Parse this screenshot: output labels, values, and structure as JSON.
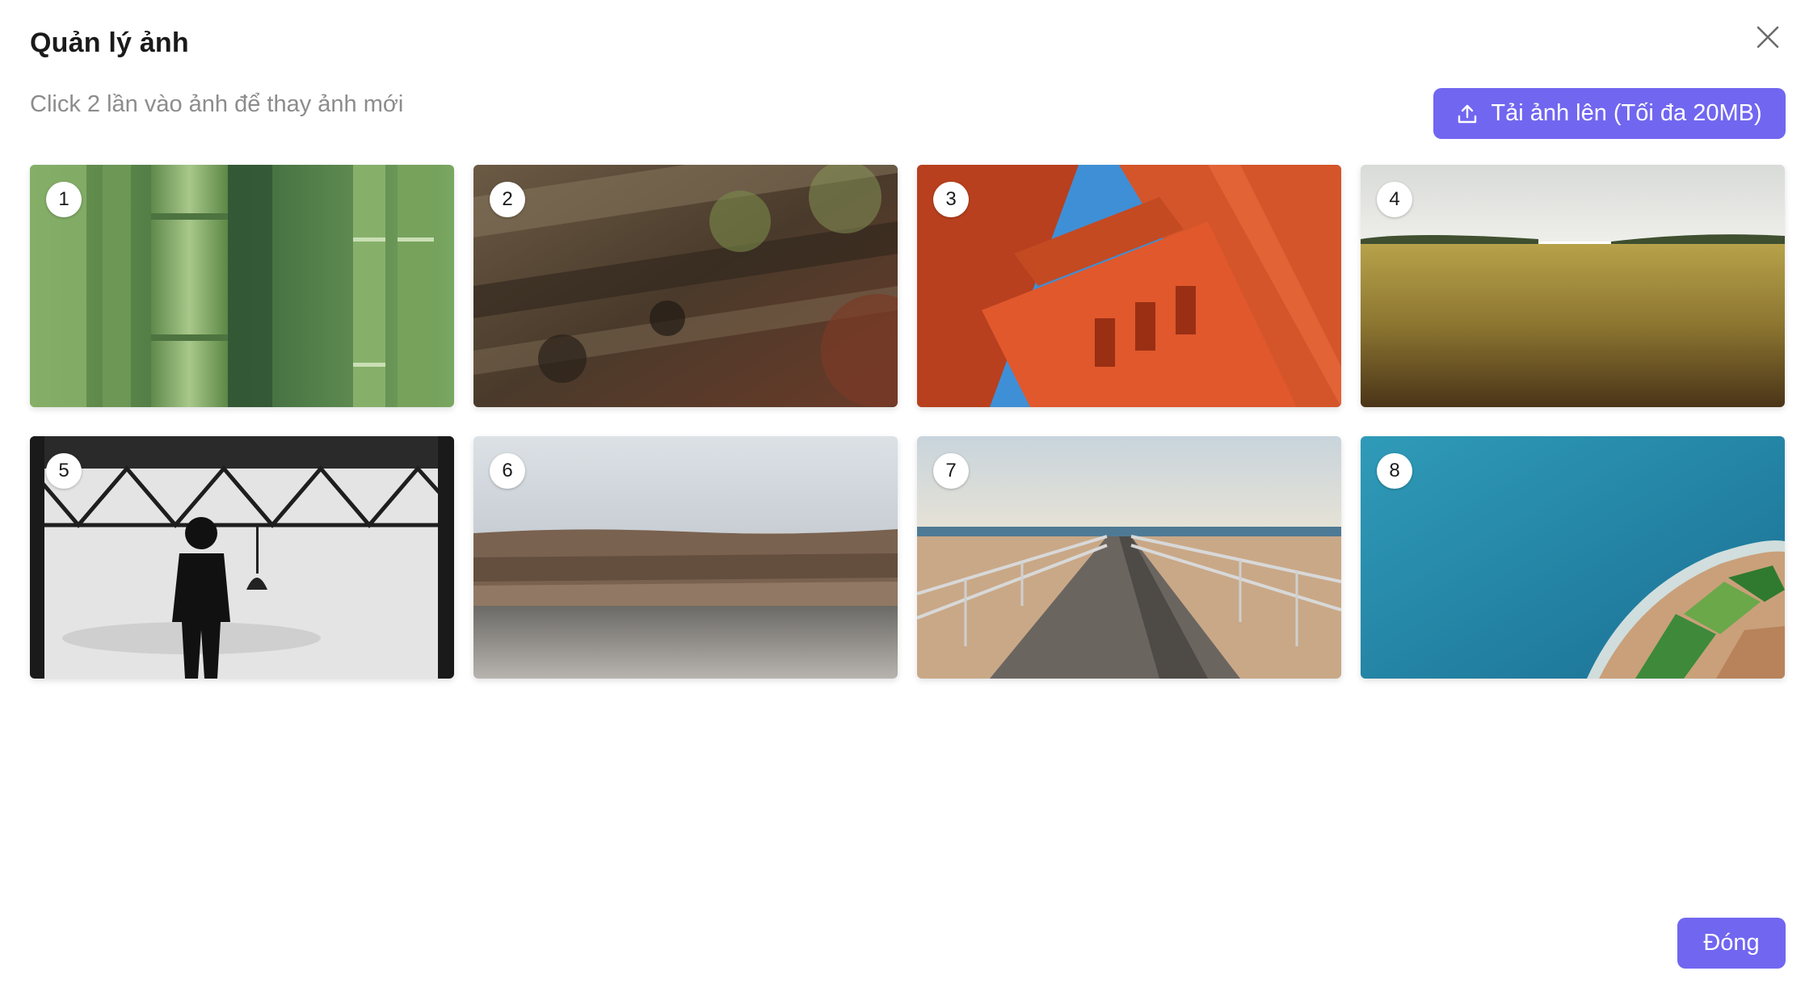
{
  "modal": {
    "title": "Quản lý ảnh",
    "hint": "Click 2 lần vào ảnh để thay ảnh mới",
    "upload_label": "Tải ảnh lên (Tối đa 20MB)",
    "upload_icon": "upload-icon",
    "close_icon": "close-icon",
    "footer_close_label": "Đóng",
    "accent_color": "#7166f0"
  },
  "images": [
    {
      "number": "1",
      "subject": "bamboo"
    },
    {
      "number": "2",
      "subject": "tree-bark"
    },
    {
      "number": "3",
      "subject": "red-bridge-tower"
    },
    {
      "number": "4",
      "subject": "wheat-field"
    },
    {
      "number": "5",
      "subject": "silhouette-hangar"
    },
    {
      "number": "6",
      "subject": "rock-breakwater"
    },
    {
      "number": "7",
      "subject": "boardwalk-pier"
    },
    {
      "number": "8",
      "subject": "aerial-coastline"
    }
  ]
}
